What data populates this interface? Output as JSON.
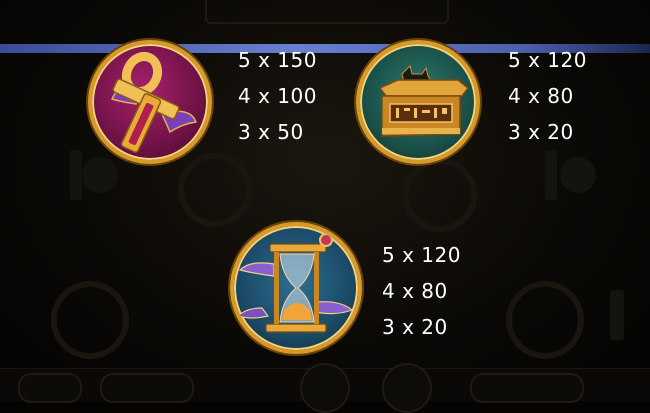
{
  "paytable": [
    {
      "symbol": "ankh",
      "icon": "ankh-icon",
      "payouts": [
        "5 x 150",
        "4 x 100",
        "3 x 50"
      ]
    },
    {
      "symbol": "anubis-chest",
      "icon": "anubis-chest-icon",
      "payouts": [
        "5 x 120",
        "4 x 80",
        "3 x 20"
      ]
    },
    {
      "symbol": "hourglass",
      "icon": "winged-hourglass-icon",
      "payouts": [
        "5 x 120",
        "4 x 80",
        "3 x 20"
      ]
    }
  ],
  "colors": {
    "frame_gold": "#d59a2a",
    "ankh_bg": "#7a1650",
    "chest_bg": "#1f5e55",
    "hourglass_bg": "#1d4f6e",
    "header_bar": "#5a6fc4"
  }
}
